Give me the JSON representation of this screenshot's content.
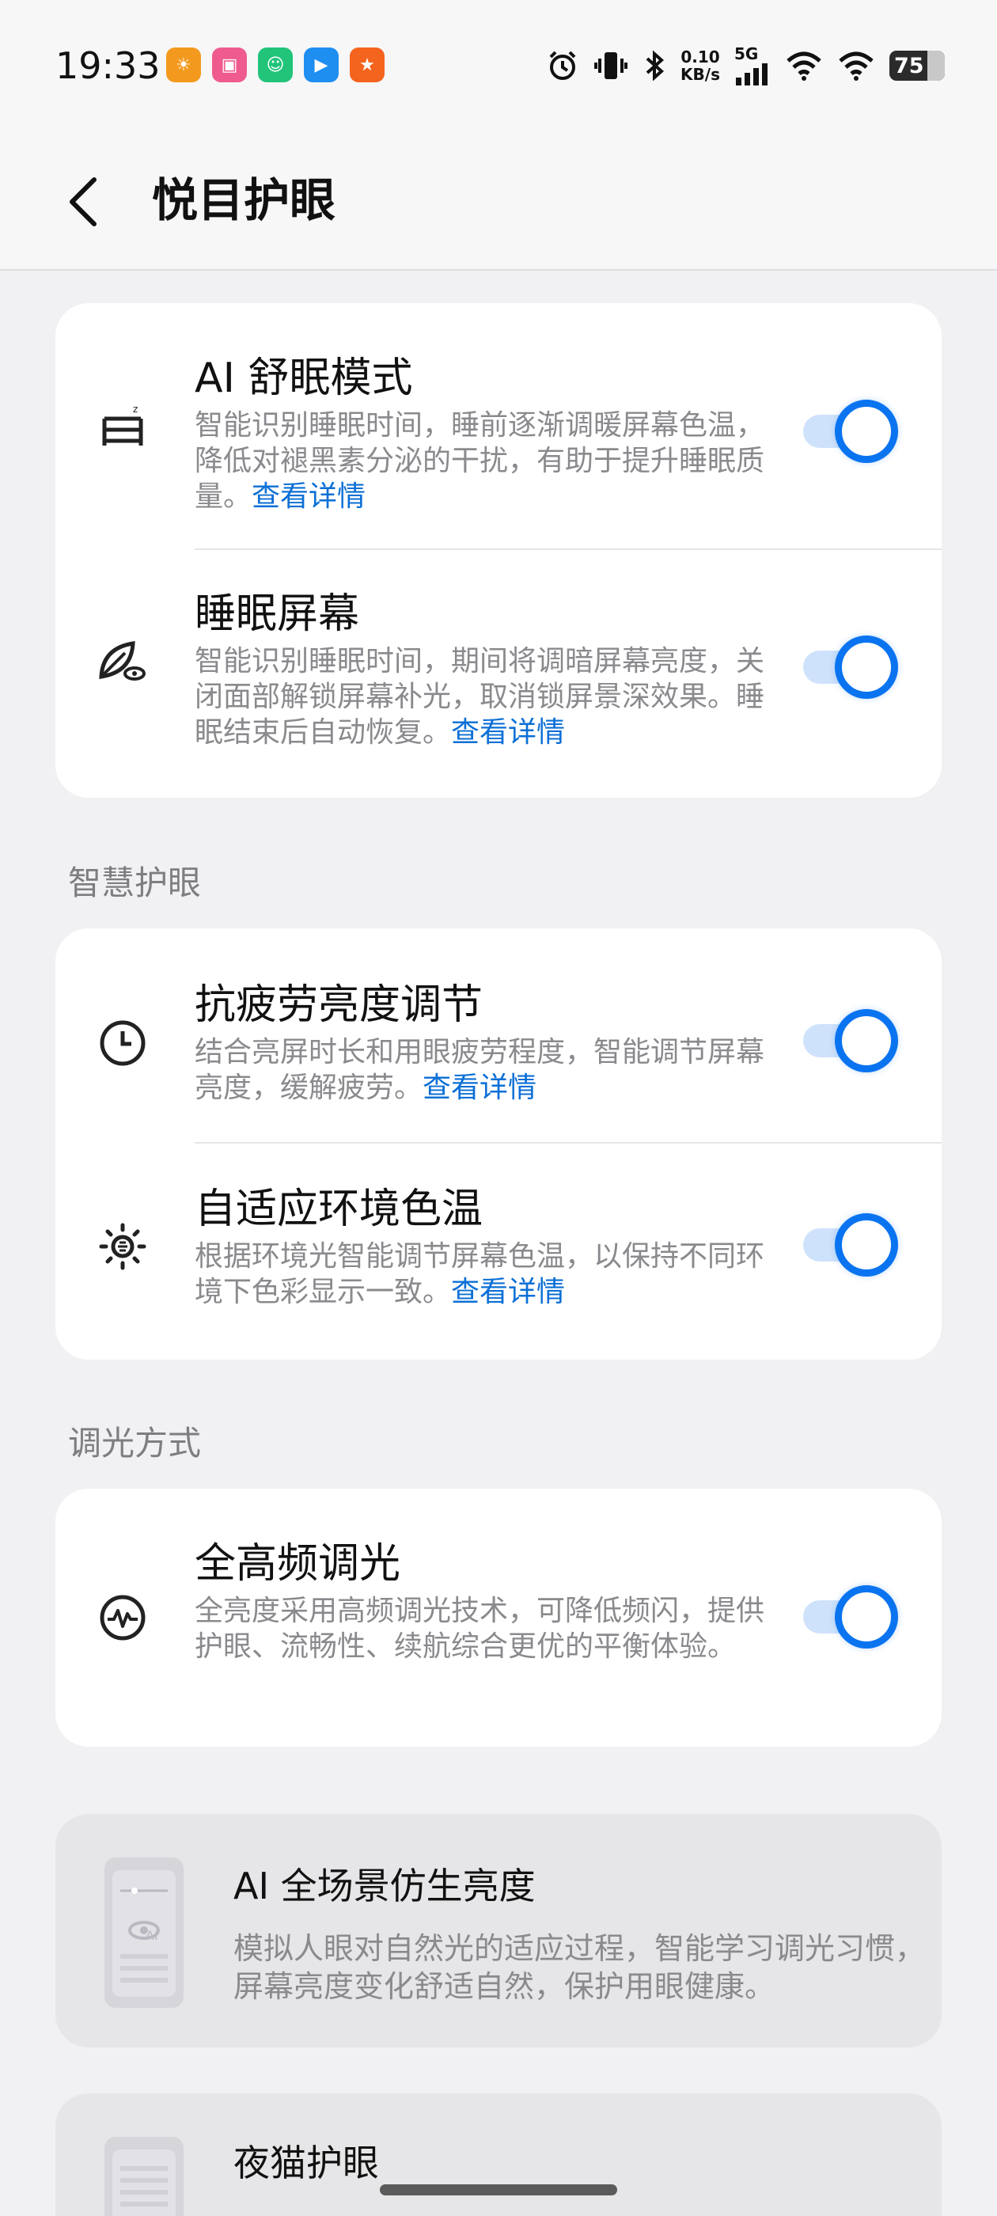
{
  "status_bar": {
    "time": "19:33",
    "net_speed_value": "0.10",
    "net_speed_unit": "KB/s",
    "network": "5G",
    "battery": "75",
    "app_icons": [
      {
        "icon": "orange-app-icon",
        "glyph": "☀",
        "color": "#f39a1e"
      },
      {
        "icon": "bilibili-icon",
        "glyph": "■",
        "color": "#ef5b8f"
      },
      {
        "icon": "green-app-icon",
        "glyph": "☺",
        "color": "#22c47a"
      },
      {
        "icon": "blue-app-icon",
        "glyph": "▶",
        "color": "#1f8ef1"
      },
      {
        "icon": "orange-figure-icon",
        "glyph": "★",
        "color": "#f5641e"
      }
    ]
  },
  "header": {
    "title": "悦目护眼"
  },
  "card1": {
    "rows": [
      {
        "title": "AI 舒眠模式",
        "desc": "智能识别睡眠时间，睡前逐渐调暖屏幕色温，降低对褪黑素分泌的干扰，有助于提升睡眠质量。",
        "link": "查看详情",
        "enabled": true
      },
      {
        "title": "睡眠屏幕",
        "desc": "智能识别睡眠时间，期间将调暗屏幕亮度，关闭面部解锁屏幕补光，取消锁屏景深效果。睡眠结束后自动恢复。",
        "link": "查看详情",
        "enabled": true
      }
    ]
  },
  "section_smart": "智慧护眼",
  "card2": {
    "rows": [
      {
        "title": "抗疲劳亮度调节",
        "desc": "结合亮屏时长和用眼疲劳程度，智能调节屏幕亮度，缓解疲劳。",
        "link": "查看详情",
        "enabled": true
      },
      {
        "title": "自适应环境色温",
        "desc": "根据环境光智能调节屏幕色温，以保持不同环境下色彩显示一致。",
        "link": "查看详情",
        "enabled": true
      }
    ]
  },
  "section_dimming": "调光方式",
  "card3": {
    "rows": [
      {
        "title": "全高频调光",
        "desc": "全亮度采用高频调光技术，可降低频闪，提供护眼、流畅性、续航综合更优的平衡体验。",
        "enabled": true
      }
    ]
  },
  "promo1": {
    "title": "AI 全场景仿生亮度",
    "desc": "模拟人眼对自然光的适应过程，智能学习调光习惯，屏幕亮度变化舒适自然，保护用眼健康。"
  },
  "promo2": {
    "title": "夜猫护眼"
  },
  "colors": {
    "accent": "#0a74f0",
    "link": "#0b6fd6"
  }
}
